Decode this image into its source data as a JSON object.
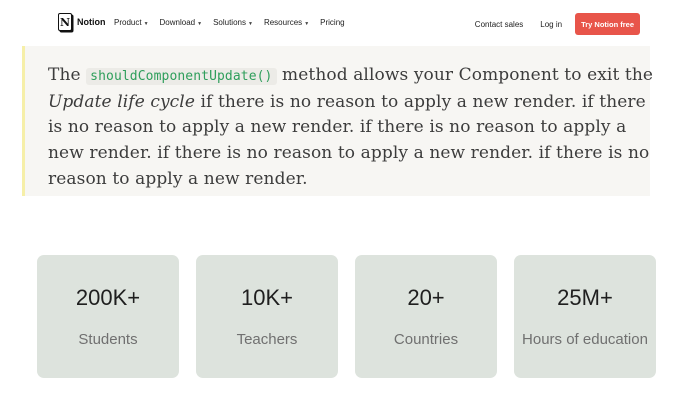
{
  "nav": {
    "brand": "Notion",
    "logo_glyph": "N",
    "menu": [
      {
        "label": "Product",
        "has_dropdown": true
      },
      {
        "label": "Download",
        "has_dropdown": true
      },
      {
        "label": "Solutions",
        "has_dropdown": true
      },
      {
        "label": "Resources",
        "has_dropdown": true
      },
      {
        "label": "Pricing",
        "has_dropdown": false
      }
    ],
    "contact_sales": "Contact sales",
    "login": "Log in",
    "cta": "Try Notion free",
    "cta_color": "#e8554a"
  },
  "content": {
    "lead": "The",
    "code": "shouldComponentUpdate()",
    "after_code": "method allows your Component to exit the",
    "emphasis": "Update life cycle",
    "rest": "if there is no reason to apply a new render. if there is no reason to apply a new render. if there is no reason to apply a new render. if there is no reason to apply a new render. if there is no reason to apply a new render.",
    "code_color": "#2e9e5b",
    "callout_bg": "#f7f6f3"
  },
  "stats": [
    {
      "value": "200K+",
      "label": "Students"
    },
    {
      "value": "10K+",
      "label": "Teachers"
    },
    {
      "value": "20+",
      "label": "Countries"
    },
    {
      "value": "25M+",
      "label": "Hours of education"
    }
  ],
  "colors": {
    "card_bg": "#dde3dd",
    "callout_accent": "#f6efa8"
  }
}
